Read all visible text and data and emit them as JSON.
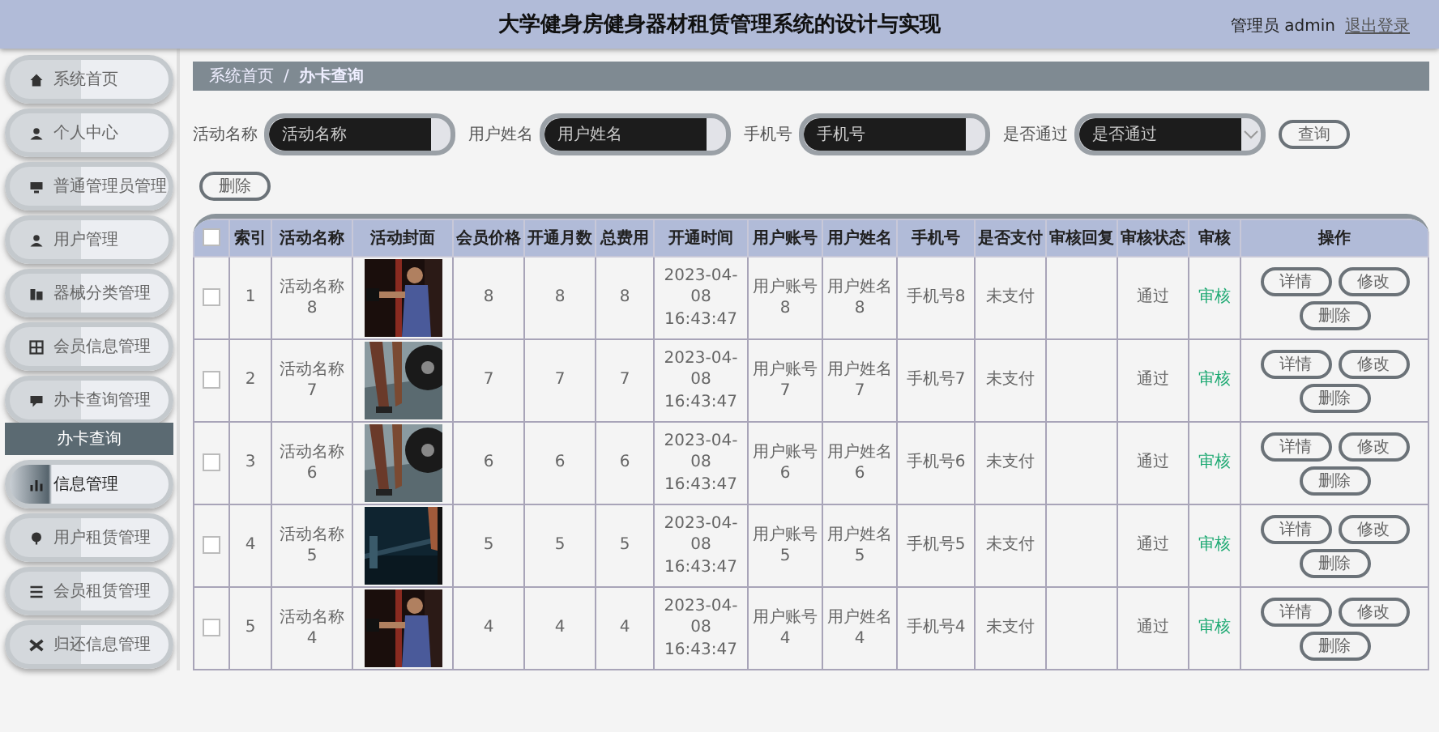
{
  "header": {
    "title": "大学健身房健身器材租赁管理系统的设计与实现",
    "user": "管理员 admin",
    "logout": "退出登录"
  },
  "sidebar": {
    "items": [
      {
        "label": "系统首页",
        "selected": false
      },
      {
        "label": "个人中心",
        "selected": false
      },
      {
        "label": "普通管理员管理",
        "selected": false
      },
      {
        "label": "用户管理",
        "selected": false
      },
      {
        "label": "器械分类管理",
        "selected": false
      },
      {
        "label": "会员信息管理",
        "selected": false
      },
      {
        "label": "办卡查询管理",
        "selected": false,
        "expanded": true,
        "children": [
          {
            "label": "办卡查询"
          }
        ]
      },
      {
        "label": "信息管理",
        "selected": true
      },
      {
        "label": "用户租赁管理",
        "selected": false
      },
      {
        "label": "会员租赁管理",
        "selected": false
      },
      {
        "label": "归还信息管理",
        "selected": false
      }
    ]
  },
  "breadcrumb": {
    "items": [
      "系统首页",
      "办卡查询"
    ],
    "separator": "/"
  },
  "search": {
    "fields": [
      {
        "label": "活动名称",
        "placeholder": "活动名称",
        "kind": "input"
      },
      {
        "label": "用户姓名",
        "placeholder": "用户姓名",
        "kind": "input"
      },
      {
        "label": "手机号",
        "placeholder": "手机号",
        "kind": "input"
      },
      {
        "label": "是否通过",
        "placeholder": "是否通过",
        "kind": "select"
      }
    ],
    "query_button": "查询"
  },
  "delete_button": "删除",
  "table": {
    "all_checked": false,
    "columns": [
      "索引",
      "活动名称",
      "活动封面",
      "会员价格",
      "开通月数",
      "总费用",
      "开通时间",
      "用户账号",
      "用户姓名",
      "手机号",
      "是否支付",
      "审核回复",
      "审核状态",
      "审核",
      "操作"
    ],
    "rows": [
      {
        "checked": false,
        "index": "1",
        "name": "活动名称8",
        "cover": {
          "kind": "picture"
        },
        "price": "8",
        "months": "8",
        "total": "8",
        "open_time": "2023-04-08 16:43:47",
        "account": "用户账号8",
        "username": "用户姓名8",
        "phone": "手机号8",
        "paid": "未支付",
        "status": "通过",
        "review": "审核",
        "actions": [
          "详情",
          "修改",
          "删除"
        ]
      },
      {
        "checked": false,
        "index": "2",
        "name": "活动名称7",
        "cover": {
          "kind": "picture"
        },
        "price": "7",
        "months": "7",
        "total": "7",
        "open_time": "2023-04-08 16:43:47",
        "account": "用户账号7",
        "username": "用户姓名7",
        "phone": "手机号7",
        "paid": "未支付",
        "status": "通过",
        "review": "审核",
        "actions": [
          "详情",
          "修改",
          "删除"
        ]
      },
      {
        "checked": false,
        "index": "3",
        "name": "活动名称6",
        "cover": {
          "kind": "picture"
        },
        "price": "6",
        "months": "6",
        "total": "6",
        "open_time": "2023-04-08 16:43:47",
        "account": "用户账号6",
        "username": "用户姓名6",
        "phone": "手机号6",
        "paid": "未支付",
        "status": "通过",
        "review": "审核",
        "actions": [
          "详情",
          "修改",
          "删除"
        ]
      },
      {
        "checked": false,
        "index": "4",
        "name": "活动名称5",
        "cover": {
          "kind": "picture"
        },
        "price": "5",
        "months": "5",
        "total": "5",
        "open_time": "2023-04-08 16:43:47",
        "account": "用户账号5",
        "username": "用户姓名5",
        "phone": "手机号5",
        "paid": "未支付",
        "status": "通过",
        "review": "审核",
        "actions": [
          "详情",
          "修改",
          "删除"
        ]
      },
      {
        "checked": false,
        "index": "5",
        "name": "活动名称4",
        "cover": {
          "kind": "picture"
        },
        "price": "4",
        "months": "4",
        "total": "4",
        "open_time": "2023-04-08 16:43:47",
        "account": "用户账号4",
        "username": "用户姓名4",
        "phone": "手机号4",
        "paid": "未支付",
        "status": "通过",
        "review": "审核",
        "actions": [
          "详情",
          "修改",
          "删除"
        ]
      }
    ]
  }
}
